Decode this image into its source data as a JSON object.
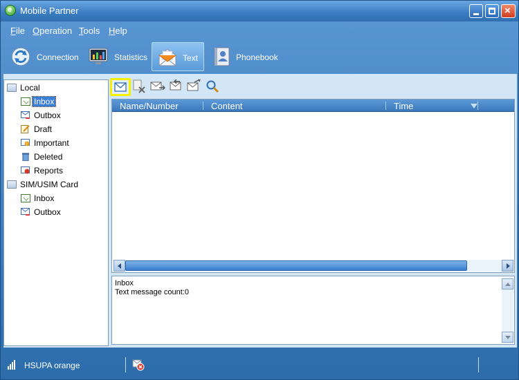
{
  "window": {
    "title": "Mobile Partner"
  },
  "menu": [
    {
      "key": "F",
      "rest": "ile"
    },
    {
      "key": "O",
      "rest": "peration"
    },
    {
      "key": "T",
      "rest": "ools"
    },
    {
      "key": "H",
      "rest": "elp"
    }
  ],
  "toolbar": {
    "connection": "Connection",
    "statistics": "Statistics",
    "text": "Text",
    "phonebook": "Phonebook"
  },
  "tree": {
    "local": "Local",
    "inbox": "Inbox",
    "outbox": "Outbox",
    "draft": "Draft",
    "important": "Important",
    "deleted": "Deleted",
    "reports": "Reports",
    "sim": "SIM/USIM Card",
    "sim_inbox": "Inbox",
    "sim_outbox": "Outbox"
  },
  "list": {
    "columns": [
      "Name/Number",
      "Content",
      "Time"
    ]
  },
  "preview": {
    "folder": "Inbox",
    "count_text": "Text message count:0"
  },
  "status": {
    "network": "HSUPA orange"
  },
  "colors": {
    "frame": "#2f6fae",
    "client": "#d3e6f6",
    "header": "#3b78bb",
    "highlight": "#f5f000",
    "selection": "#3a7dd6"
  }
}
